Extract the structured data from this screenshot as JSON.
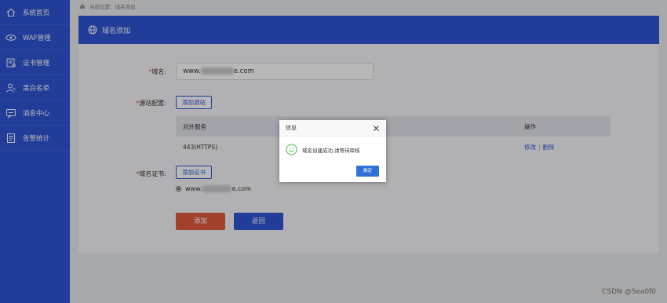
{
  "sidebar": {
    "items": [
      {
        "label": "系统首页",
        "icon": "home-icon"
      },
      {
        "label": "WAF管理",
        "icon": "waf-icon"
      },
      {
        "label": "证书管理",
        "icon": "certificate-icon"
      },
      {
        "label": "黑白名单",
        "icon": "user-list-icon"
      },
      {
        "label": "消息中心",
        "icon": "message-icon"
      },
      {
        "label": "告警统计",
        "icon": "alarm-stats-icon"
      }
    ]
  },
  "breadcrumb": {
    "text": "当前位置：域名添加"
  },
  "card": {
    "title": "域名添加"
  },
  "form": {
    "domain_label": "域名:",
    "domain_prefix": "www.",
    "domain_suffix": "e.com",
    "origin_label": "源站配置:",
    "add_origin_button": "添加源站",
    "table": {
      "headers": [
        "对外服务",
        "操作"
      ],
      "rows": [
        {
          "service": "443(HTTPS)",
          "edit": "修改",
          "sep": "|",
          "delete": "删除"
        }
      ]
    },
    "cert_label": "域名证书:",
    "add_cert_button": "添加证书",
    "cert_option_prefix": "www.",
    "cert_option_suffix": "e.com",
    "submit_button": "添加",
    "back_button": "返回"
  },
  "dialog": {
    "title": "信息",
    "message": "域名创建成功,请等待审核",
    "ok_button": "确定"
  },
  "watermark": "CSDN @Sea0f0",
  "colors": {
    "primary": "#2f55d4",
    "danger": "#e05a3e",
    "required": "#e0473b"
  }
}
